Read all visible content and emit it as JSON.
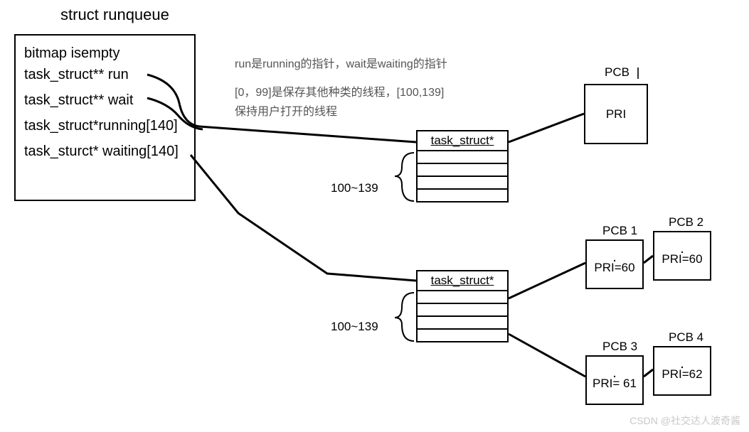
{
  "title": "struct runqueue",
  "struct_members": {
    "m1": "bitmap isempty",
    "m2": "task_struct** run",
    "m3": "task_struct** wait",
    "m4": "task_struct*running[140]",
    "m5": "task_sturct* waiting[140]"
  },
  "desc": {
    "line1": "run是running的指针，wait是waiting的指针",
    "line2": "[0，99]是保存其他种类的线程，[100,139]",
    "line3": "保持用户打开的线程"
  },
  "array_boxes": {
    "label1": "task_struct*",
    "label2": "task_struct*",
    "range": "100~139"
  },
  "pcb": {
    "pcb_top_title": "PCB",
    "pcb_top_content": "PRI",
    "pcb1_title": "PCB 1",
    "pcb1_content": "PRI=60",
    "pcb2_title": "PCB 2",
    "pcb2_content": "PRI=60",
    "pcb3_title": "PCB 3",
    "pcb3_content": "PRI= 61",
    "pcb4_title": "PCB 4",
    "pcb4_content": "PRI=62"
  },
  "watermark": "CSDN @社交达人波奇酱"
}
